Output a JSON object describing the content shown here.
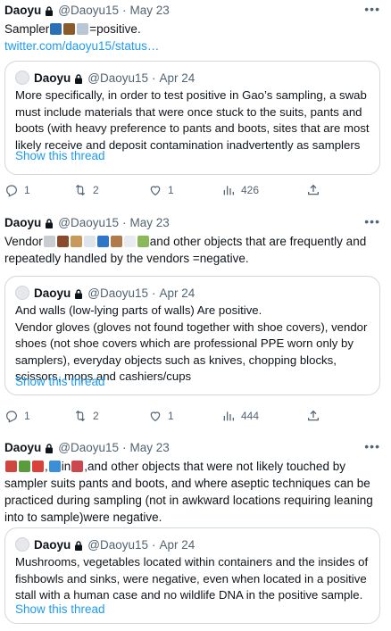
{
  "tweets": [
    {
      "author": "Daoyu",
      "handle": "@Daoyu15",
      "date": "May 23",
      "text_lines": [
        "=positive."
      ],
      "text_prefix": "Sampler",
      "link": "twitter.com/daoyu15/status…",
      "quote": {
        "author": "Daoyu",
        "handle": "@Daoyu15",
        "date": "Apr 24",
        "text": "More specifically, in order to test positive in Gao’s sampling, a swab must include materials that were once stuck to the suits, pants and boots (with heavy preference to pants and boots, sites that are most likely receive and deposit contamination inadvertently as samplers",
        "show_thread": "Show this thread"
      },
      "actions": {
        "replies": "1",
        "retweets": "2",
        "likes": "1",
        "views": "426"
      }
    },
    {
      "author": "Daoyu",
      "handle": "@Daoyu15",
      "date": "May 23",
      "text_prefix": "Vendor",
      "text": "and other objects that are frequently and repeatedly handled by the vendors =negative.",
      "quote": {
        "author": "Daoyu",
        "handle": "@Daoyu15",
        "date": "Apr 24",
        "text": "And walls (low-lying parts of walls) Are positive.\nVendor gloves (gloves not found together with shoe covers), vendor shoes (not shoe covers which are professional PPE worn only by samplers), everyday objects such as knives, chopping blocks, scissors, mops and cashiers/cups",
        "show_thread": "Show this thread"
      },
      "actions": {
        "replies": "1",
        "retweets": "2",
        "likes": "1",
        "views": "444"
      }
    },
    {
      "author": "Daoyu",
      "handle": "@Daoyu15",
      "date": "May 23",
      "text_mid": "in",
      "text": ",and other objects that were not likely touched by sampler suits pants and boots, and where aseptic techniques can be practiced during sampling (not in awkward locations requiring leaning into to sample)were negative.",
      "quote": {
        "author": "Daoyu",
        "handle": "@Daoyu15",
        "date": "Apr 24",
        "text": "Mushrooms, vegetables located within containers and the insides of fishbowls and sinks, were negative, even when located in a positive stall with a human case and no wildlife DNA in the positive sample.",
        "show_thread": "Show this thread"
      }
    }
  ]
}
